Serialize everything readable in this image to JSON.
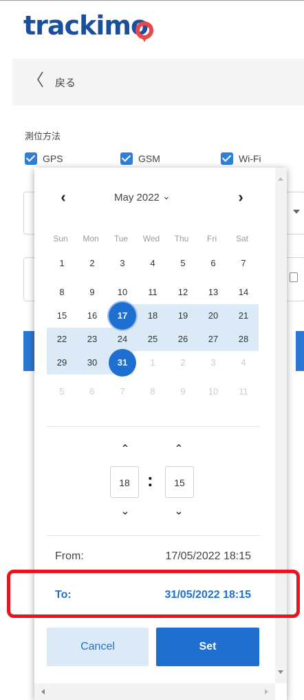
{
  "header": {
    "logo_text": "trackimo",
    "logo_pin_color": "#e8484a",
    "brand_color": "#1a4f9c"
  },
  "nav": {
    "back_label": "戻る"
  },
  "positioning": {
    "title": "測位方法",
    "options": [
      {
        "label": "GPS",
        "checked": true
      },
      {
        "label": "GSM",
        "checked": true
      },
      {
        "label": "Wi-Fi",
        "checked": true
      }
    ]
  },
  "datepicker": {
    "month_label": "May 2022",
    "weekdays": [
      "Sun",
      "Mon",
      "Tue",
      "Wed",
      "Thu",
      "Fri",
      "Sat"
    ],
    "weeks": [
      [
        "1",
        "2",
        "3",
        "4",
        "5",
        "6",
        "7"
      ],
      [
        "8",
        "9",
        "10",
        "11",
        "12",
        "13",
        "14"
      ],
      [
        "15",
        "16",
        "17",
        "18",
        "19",
        "20",
        "21"
      ],
      [
        "22",
        "23",
        "24",
        "25",
        "26",
        "27",
        "28"
      ],
      [
        "29",
        "30",
        "31",
        "1",
        "2",
        "3",
        "4"
      ],
      [
        "5",
        "6",
        "7",
        "8",
        "9",
        "10",
        "11"
      ]
    ],
    "range_start_day": "17",
    "range_end_day": "31",
    "time": {
      "hour": "18",
      "minute": "15",
      "separator": ":"
    },
    "from": {
      "label": "From:",
      "value": "17/05/2022 18:15"
    },
    "to": {
      "label": "To:",
      "value": "31/05/2022 18:15"
    },
    "cancel_label": "Cancel",
    "set_label": "Set",
    "accent_color": "#1f6fd0",
    "range_color": "#dce9f7"
  },
  "annotation": {
    "highlight_color": "#e8141e"
  }
}
